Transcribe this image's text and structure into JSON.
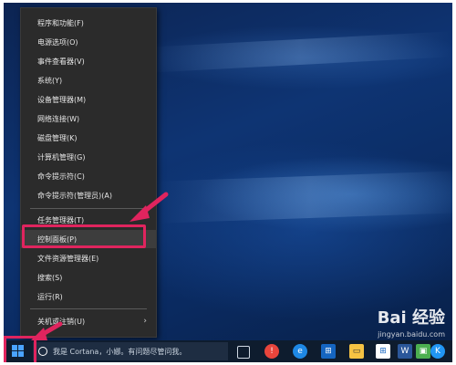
{
  "context_menu": {
    "items": [
      {
        "label": "程序和功能(F)"
      },
      {
        "label": "电源选项(O)"
      },
      {
        "label": "事件查看器(V)"
      },
      {
        "label": "系统(Y)"
      },
      {
        "label": "设备管理器(M)"
      },
      {
        "label": "网络连接(W)"
      },
      {
        "label": "磁盘管理(K)"
      },
      {
        "label": "计算机管理(G)"
      },
      {
        "label": "命令提示符(C)"
      },
      {
        "label": "命令提示符(管理员)(A)"
      },
      {
        "label": "任务管理器(T)"
      },
      {
        "label": "控制面板(P)"
      },
      {
        "label": "文件资源管理器(E)"
      },
      {
        "label": "搜索(S)"
      },
      {
        "label": "运行(R)"
      },
      {
        "label": "关机或注销(U)"
      }
    ],
    "submenu_arrow": "›",
    "highlighted_index": 11
  },
  "taskbar": {
    "search_placeholder": "我是 Cortana，小娜。有问题尽管问我。",
    "icons": [
      "task-view-icon",
      "app-icon-red",
      "edge-icon",
      "store-icon",
      "folder-icon",
      "windows-store-icon",
      "word-icon",
      "tablet-icon",
      "chrome-icon",
      "k-app-icon"
    ]
  },
  "watermark": {
    "main": "Bai 经验",
    "sub": "jingyan.baidu.com"
  },
  "colors": {
    "highlight_border": "#e0245e",
    "menu_bg": "#2b2b2b",
    "taskbar_bg": "#0e1c2e",
    "desktop_bg": "#0a2a58"
  }
}
